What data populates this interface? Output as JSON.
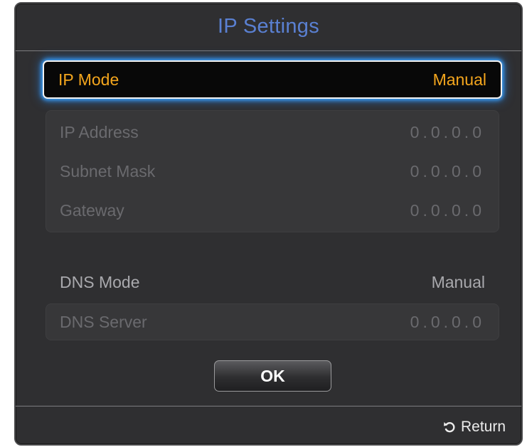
{
  "dialog": {
    "title": "IP Settings"
  },
  "ip_mode": {
    "label": "IP Mode",
    "value": "Manual"
  },
  "ip_fields": [
    {
      "label": "IP Address",
      "value": "0.0.0.0"
    },
    {
      "label": "Subnet Mask",
      "value": "0.0.0.0"
    },
    {
      "label": "Gateway",
      "value": "0.0.0.0"
    }
  ],
  "dns_mode": {
    "label": "DNS Mode",
    "value": "Manual"
  },
  "dns_server": {
    "label": "DNS Server",
    "value": "0.0.0.0"
  },
  "buttons": {
    "ok_label": "OK"
  },
  "footer": {
    "return_label": "Return",
    "return_icon": "return-arrow-icon"
  },
  "colors": {
    "title": "#5a80d2",
    "focus_text": "#f4a61d",
    "focus_glow": "#3aa3ff",
    "disabled_text": "#6a6a6e",
    "enabled_text": "#a9a9ad",
    "background": "#2f2f31"
  }
}
